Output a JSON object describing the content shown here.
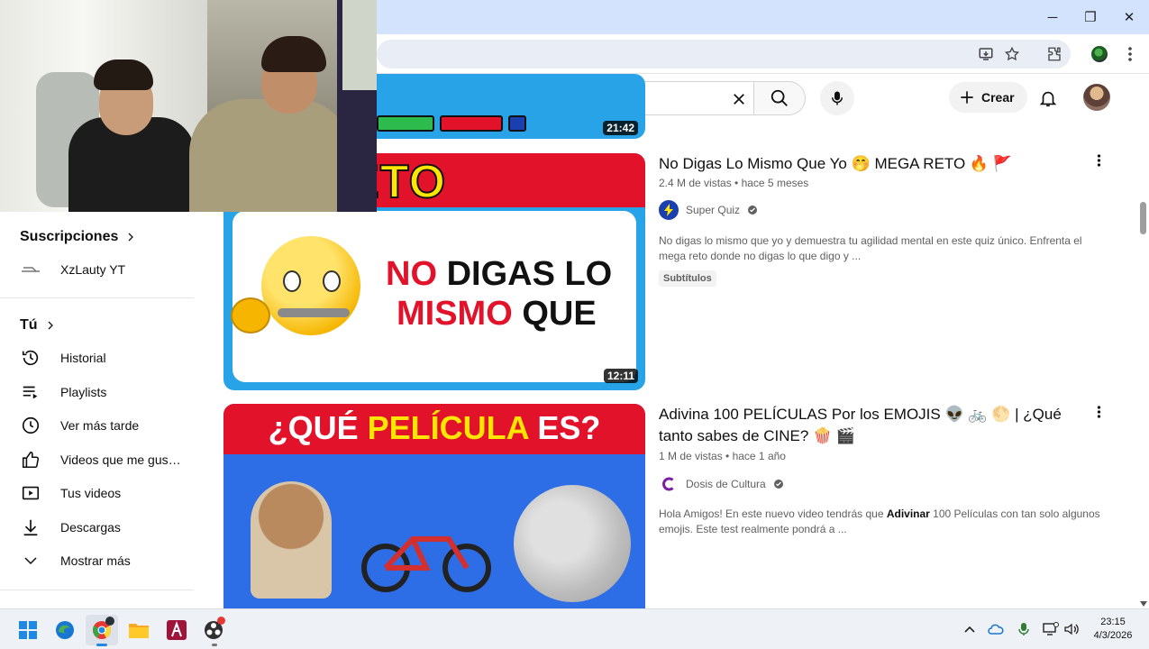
{
  "window": {
    "minimize": "─",
    "maximize": "❐",
    "close": "✕"
  },
  "header": {
    "create_label": "Crear"
  },
  "sidebar": {
    "subscriptions_title": "Suscripciones",
    "subscriptions": [
      {
        "label": "XzLauty YT"
      }
    ],
    "you_title": "Tú",
    "items": [
      {
        "label": "Historial"
      },
      {
        "label": "Playlists"
      },
      {
        "label": "Ver más tarde"
      },
      {
        "label": "Videos que me gus…"
      },
      {
        "label": "Tus videos"
      },
      {
        "label": "Descargas"
      },
      {
        "label": "Mostrar más"
      }
    ]
  },
  "videos": [
    {
      "duration": "21:42"
    },
    {
      "title": "No Digas Lo Mismo Que Yo 🤭 MEGA RETO 🔥 🚩",
      "views": "2.4 M de vistas",
      "age": "hace 5 meses",
      "channel": "Super Quiz",
      "description": "No digas lo mismo que yo y demuestra tu agilidad mental en este quiz único. Enfrenta el mega reto donde no digas lo que digo y ...",
      "badge": "Subtítulos",
      "duration": "12:11",
      "thumb_top": "GA RETO",
      "thumb_line1a": "NO ",
      "thumb_line1b": "DIGAS LO",
      "thumb_line2a": "MISMO ",
      "thumb_line2b": "QUE"
    },
    {
      "title": "Adivina 100 PELÍCULAS Por los EMOJIS 👽 🚲 🌕 | ¿Qué tanto sabes de CINE? 🍿 🎬",
      "views": "1 M de vistas",
      "age": "hace 1 año",
      "channel": "Dosis de Cultura",
      "description_pre": "Hola Amigos! En este nuevo video tendrás que ",
      "description_bold": "Adivinar",
      "description_post": " 100 Películas con tan solo algunos emojis. Este test realmente pondrá a ...",
      "thumb_q1": "¿QUÉ ",
      "thumb_q2": "PELÍCULA",
      "thumb_q3": " ES?"
    }
  ],
  "taskbar": {
    "time": "23:15",
    "date": "4/3/2026"
  },
  "colors": {
    "accent_yellow": "#ffe600",
    "accent_red": "#e3122b",
    "thumb_blue": "#2196f3",
    "titlebar": "#d3e3fd"
  }
}
